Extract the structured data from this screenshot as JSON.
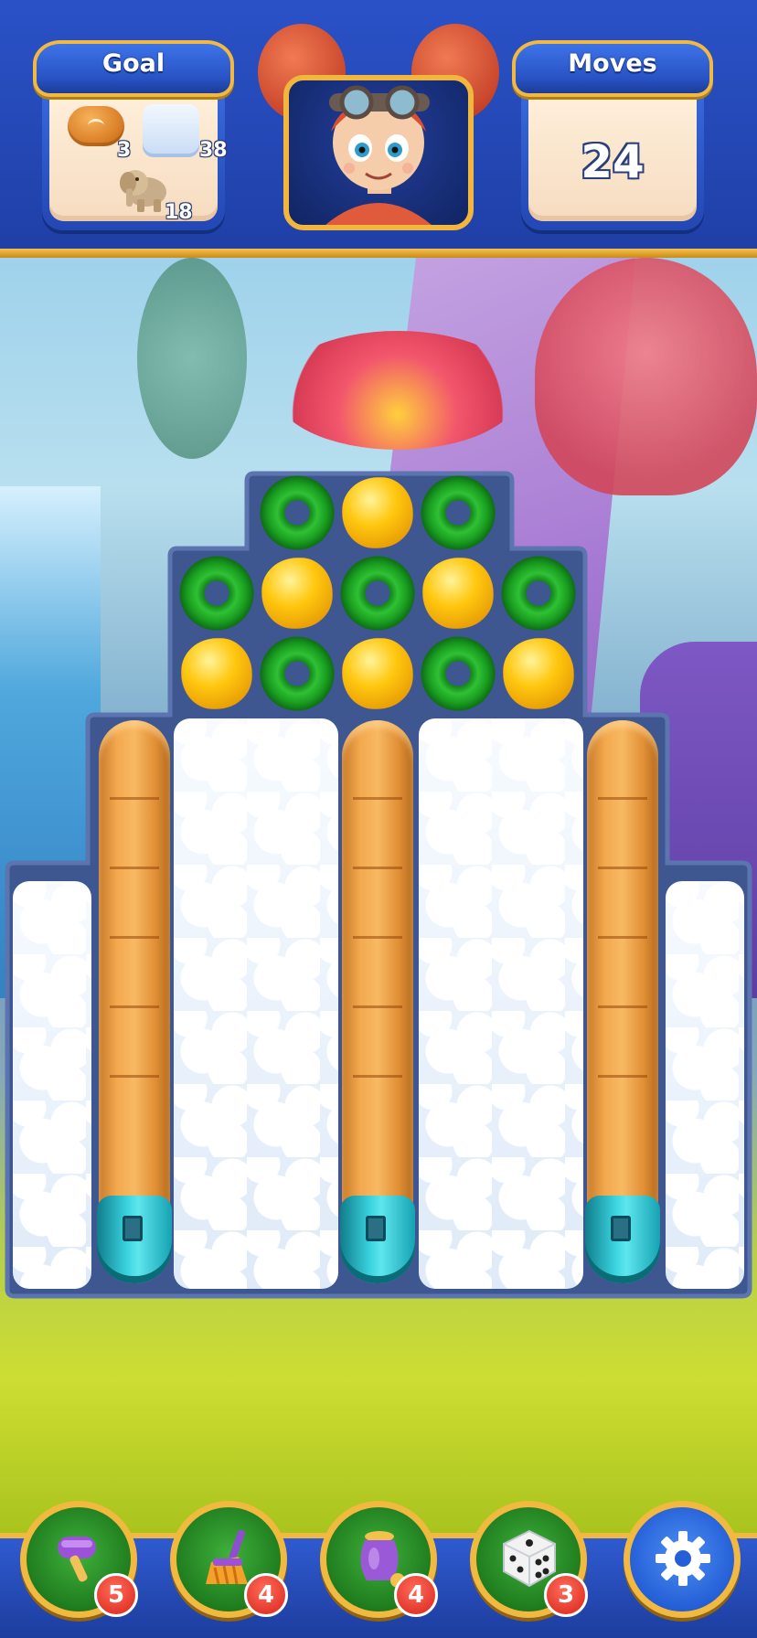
{
  "header": {
    "goal_label": "Goal",
    "moves_label": "Moves",
    "moves_value": "24",
    "goals": [
      {
        "icon": "baguette-icon",
        "count": "3"
      },
      {
        "icon": "snow-block-icon",
        "count": "38"
      },
      {
        "icon": "elephant-toy-icon",
        "count": "18"
      }
    ],
    "character": "red-haired-girl-with-goggles"
  },
  "board": {
    "row1": [
      "green-donut",
      "yellow-lemon",
      "green-donut"
    ],
    "row2": [
      "green-donut",
      "yellow-lemon",
      "green-donut",
      "yellow-lemon",
      "green-donut"
    ],
    "row3": [
      "yellow-lemon",
      "green-donut",
      "yellow-lemon",
      "green-donut",
      "yellow-lemon"
    ],
    "baguettes": 3,
    "snow_columns": 4
  },
  "boosters": [
    {
      "icon": "mallet-icon",
      "count": "5"
    },
    {
      "icon": "broom-icon",
      "count": "4"
    },
    {
      "icon": "potion-jar-icon",
      "count": "4"
    },
    {
      "icon": "dice-icon",
      "count": "3"
    },
    {
      "icon": "gear-icon",
      "count": ""
    }
  ],
  "colors": {
    "header_blue": "#1f3fa6",
    "gold_rim": "#f1b940",
    "donut_green": "#2fc134",
    "lemon_yellow": "#ffc70f",
    "badge_red": "#d8241a"
  }
}
